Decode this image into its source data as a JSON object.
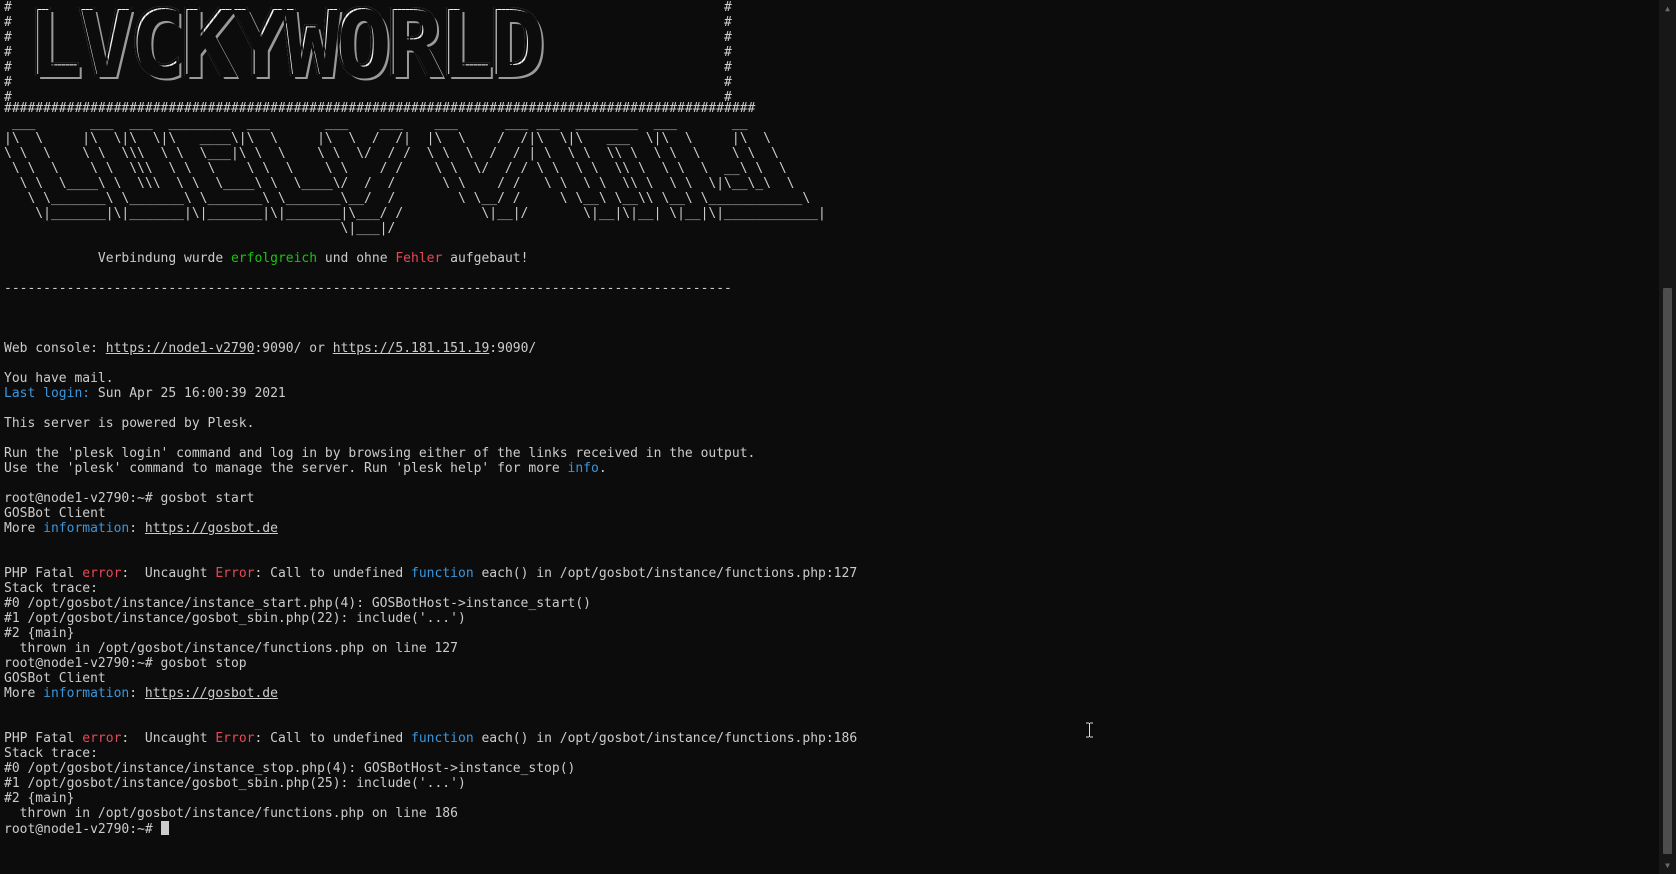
{
  "banner": {
    "title": "LVCKYWORLD",
    "hash_left": "#\n#\n#\n#\n#\n#\n#",
    "hash_right": "#\n#\n#\n#\n#\n#\n#",
    "separator": "################################################################################################"
  },
  "ascii_art": " ___       ___  ___  ________  ___       ___    ___    ___      ___ ___  ________  ___       __      \n|\\  \\     |\\  \\|\\  \\|\\   ____\\|\\  \\     |\\  \\  /  /|  |\\  \\    /  /|\\  \\|\\   ___  \\|\\  \\     |\\  \\    \n\\ \\  \\    \\ \\  \\\\\\  \\ \\  \\___|\\ \\  \\    \\ \\  \\/  / /  \\ \\  \\  /  / | \\  \\ \\  \\\\ \\  \\ \\  \\    \\ \\  \\   \n \\ \\  \\    \\ \\  \\\\\\  \\ \\  \\    \\ \\  \\    \\ \\    / /    \\ \\  \\/  / / \\ \\  \\ \\  \\\\ \\  \\ \\  \\  __\\ \\  \\  \n  \\ \\  \\____\\ \\  \\\\\\  \\ \\  \\____\\ \\  \\____\\/  /  /      \\ \\    / /   \\ \\  \\ \\  \\\\ \\  \\ \\  \\|\\__\\_\\  \\ \n   \\ \\_______\\ \\_______\\ \\_______\\ \\_______\\__/  /        \\ \\__/ /     \\ \\__\\ \\__\\\\ \\__\\ \\____________\\\n    \\|_______|\\|_______|\\|_______|\\|_______|\\___/ /          \\|__|/       \\|__|\\|__| \\|__|\\|____________|\n                                           \\|___|/                                                   ",
  "connection": {
    "indent": "            ",
    "part1": "Verbindung wurde ",
    "success_word": "erfolgreich",
    "part2": " und ohne ",
    "error_word": "Fehler",
    "part3": " aufgebaut!"
  },
  "dash_line": "---------------------------------------------------------------------------------------------",
  "web_console": {
    "prefix": "Web console: ",
    "link1": "https://node1-v2790",
    "port1": ":9090/ or ",
    "link2": "https://5.181.151.19",
    "port2": ":9090/"
  },
  "mail": "You have mail.",
  "last_login": {
    "label": "Last login:",
    "value": " Sun Apr 25 16:00:39 2021"
  },
  "powered": "This server is powered by Plesk.",
  "run_line1": "Run the 'plesk login' command and log in by browsing either of the links received in the output.",
  "run_line2": {
    "text": "Use the 'plesk' command to manage the server. Run 'plesk help' for more ",
    "info": "info",
    "end": "."
  },
  "session1": {
    "prompt": "root@node1-v2790:~# gosbot start",
    "client": "GOSBot Client",
    "more_prefix": "More ",
    "more_info": "information",
    "more_colon": ": ",
    "more_link": "https://gosbot.de",
    "err_prefix": "PHP Fatal ",
    "err_word": "error",
    "err_mid": ":  Uncaught ",
    "err_Error": "Error",
    "err_mid2": ": Call to undefined ",
    "err_function": "function",
    "err_end": " each() in /opt/gosbot/instance/functions.php:127",
    "trace": "Stack trace:",
    "t0": "#0 /opt/gosbot/instance/instance_start.php(4): GOSBotHost->instance_start()",
    "t1": "#1 /opt/gosbot/instance/gosbot_sbin.php(22): include('...')",
    "t2": "#2 {main}",
    "thrown": "  thrown in /opt/gosbot/instance/functions.php on line 127"
  },
  "session2": {
    "prompt": "root@node1-v2790:~# gosbot stop",
    "client": "GOSBot Client",
    "more_prefix": "More ",
    "more_info": "information",
    "more_colon": ": ",
    "more_link": "https://gosbot.de",
    "err_prefix": "PHP Fatal ",
    "err_word": "error",
    "err_mid": ":  Uncaught ",
    "err_Error": "Error",
    "err_mid2": ": Call to undefined ",
    "err_function": "function",
    "err_end": " each() in /opt/gosbot/instance/functions.php:186",
    "trace": "Stack trace:",
    "t0": "#0 /opt/gosbot/instance/instance_stop.php(4): GOSBotHost->instance_stop()",
    "t1": "#1 /opt/gosbot/instance/gosbot_sbin.php(25): include('...')",
    "t2": "#2 {main}",
    "thrown": "  thrown in /opt/gosbot/instance/functions.php on line 186"
  },
  "final_prompt": "root@node1-v2790:~# ",
  "colors": {
    "success": "#16c60c",
    "error": "#e74856",
    "info": "#3a96dd",
    "bg": "#0c0c0c",
    "fg": "#cccccc"
  },
  "icons": {
    "cursor": "text-ibeam-cursor-icon",
    "scroll_up": "scroll-up-arrow-icon",
    "scroll_down": "scroll-down-arrow-icon"
  }
}
